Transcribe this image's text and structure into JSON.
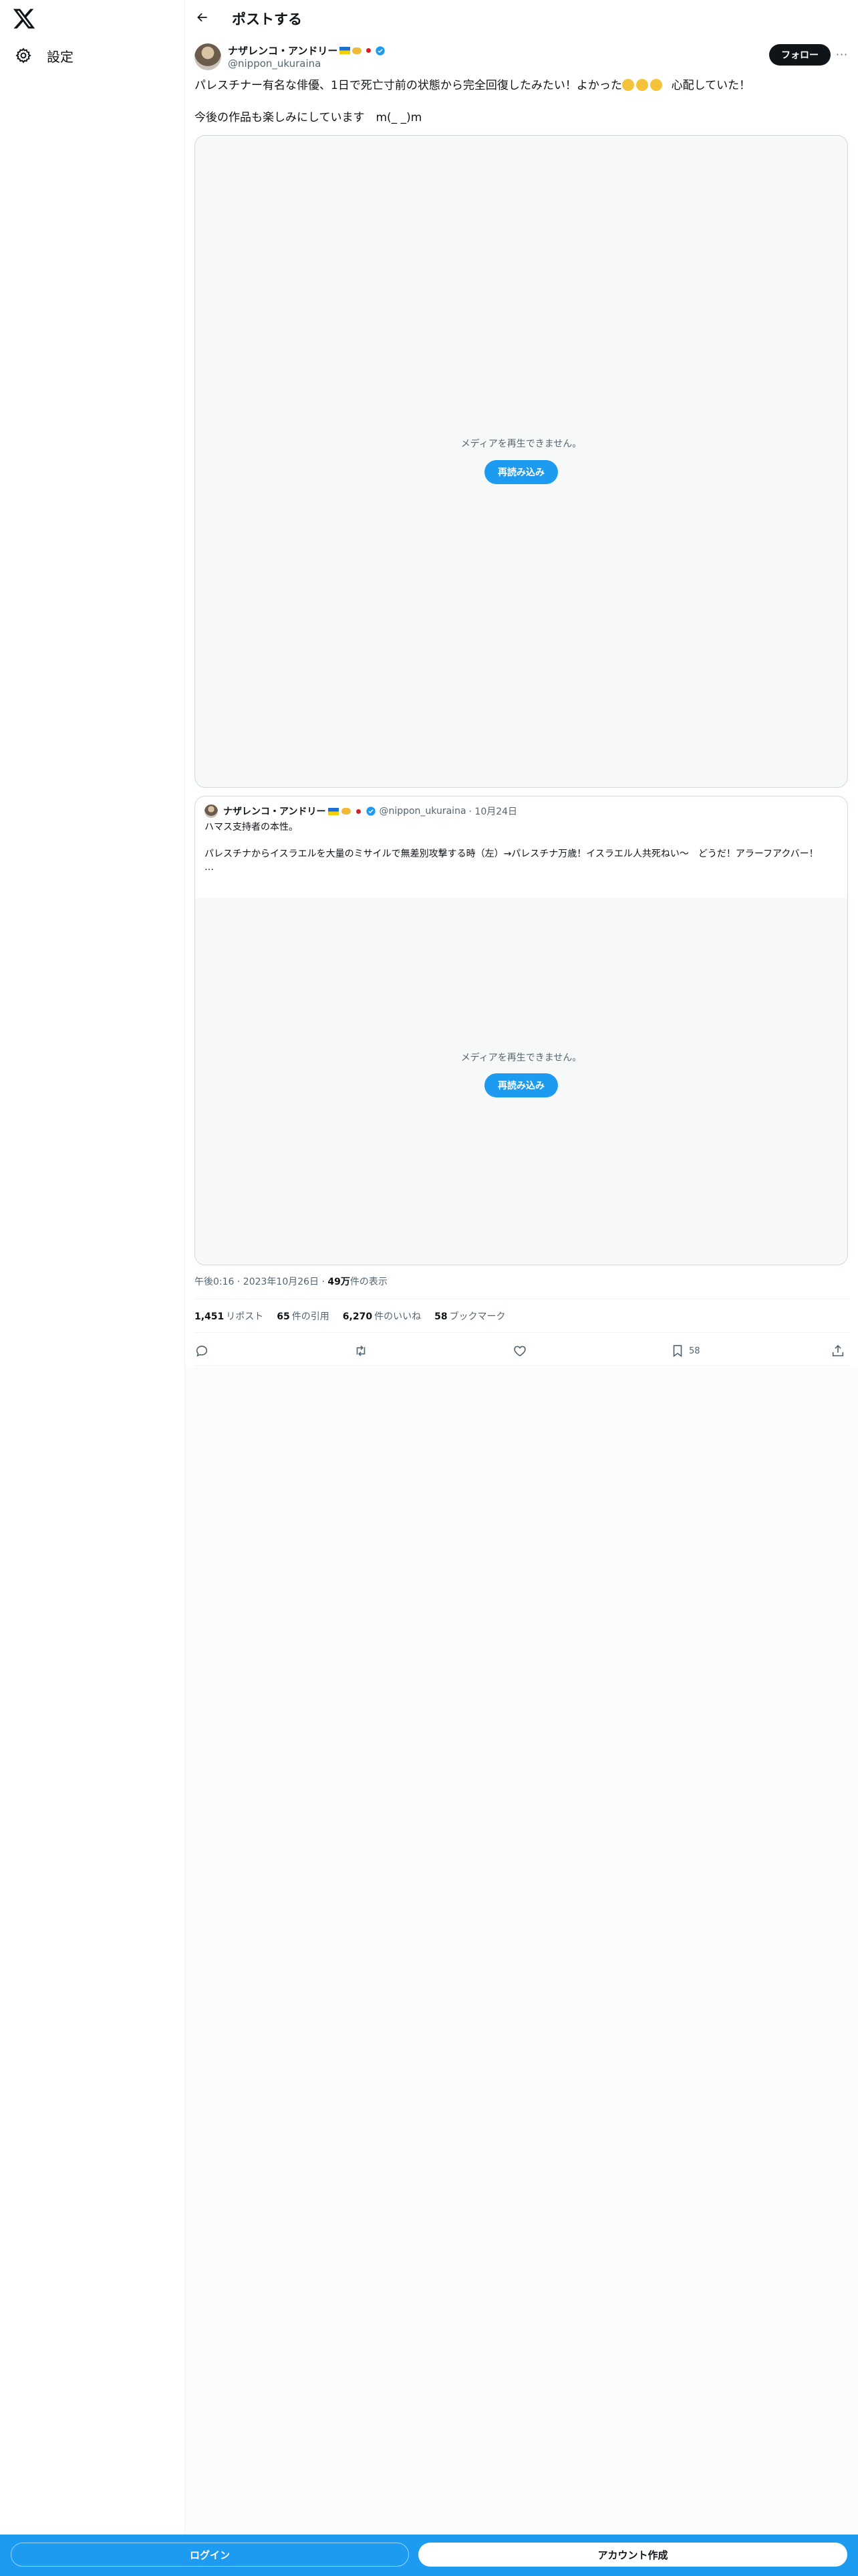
{
  "colors": {
    "accent": "#1d9bf0",
    "text": "#0f1419",
    "secondary": "#536471",
    "follow_bg": "#0f1419"
  },
  "sidebar": {
    "logo_icon": "x-logo-icon",
    "settings": {
      "icon": "gear-icon",
      "label": "設定"
    }
  },
  "header": {
    "back_icon": "arrow-left-icon",
    "title": "ポストする"
  },
  "post": {
    "author_name": "ナザレンコ・アンドリー",
    "author_handle": "@nippon_ukuraina",
    "follow_label": "フォロー",
    "more_label": "···",
    "text_line1": "パレスチナー有名な俳優、1日で死亡寸前の状態から完全回復したみたい！よかった",
    "text_line1_suffix": "心配していた！",
    "text_line2": "今後の作品も楽しみにしています　m(_ _)m",
    "media_message": "メディアを再生できません。",
    "reload_label": "再読み込み",
    "time": "午後0:16 · 2023年10月26日 ·",
    "views_count": "49万",
    "views_label": "件の表示"
  },
  "quote": {
    "author_name": "ナザレンコ・アンドリー",
    "handle": "@nippon_ukuraina",
    "date": "· 10月24日",
    "line1": "ハマス支持者の本性。",
    "line2": "パレスチナからイスラエルを大量のミサイルで無差別攻撃する時（左）→パレスチナ万歳！イスラエル人共死ねい～　どうだ！アラーフアクバー！",
    "ellipsis": "…",
    "media_message": "メディアを再生できません。",
    "reload_label": "再読み込み"
  },
  "stats": {
    "reposts_count": "1,451",
    "reposts_label": "リポスト",
    "quotes_count": "65",
    "quotes_label": "件の引用",
    "likes_count": "6,270",
    "likes_label": "件のいいね",
    "bookmarks_count": "58",
    "bookmarks_label": "ブックマーク"
  },
  "actions": {
    "reply_icon": "reply-icon",
    "repost_icon": "repost-icon",
    "like_icon": "heart-icon",
    "bookmark_icon": "bookmark-icon",
    "bookmark_count": "58",
    "share_icon": "share-icon"
  },
  "bottom_bar": {
    "login_label": "ログイン",
    "signup_label": "アカウント作成"
  }
}
